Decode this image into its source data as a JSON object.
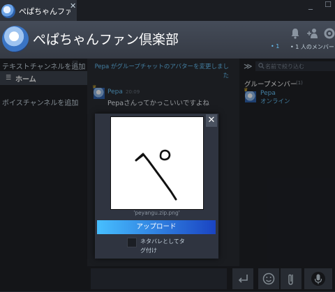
{
  "tab": {
    "title": "ぺぱちゃんファン",
    "close": "✕"
  },
  "window": {
    "minimize": "_",
    "maximize": "☐"
  },
  "header": {
    "group_name": "ぺぱちゃんファン倶楽部",
    "online_count": "• 1",
    "member_count": "• 1 人のメンバー"
  },
  "sidebar": {
    "add_text_channel": "テキストチャンネルを追加",
    "home_label": "ホーム",
    "add_voice_channel": "ボイスチャンネルを追加"
  },
  "chat": {
    "system_message": "Pepa がグループチャットのアバターを変更しました",
    "messages": [
      {
        "author": "Pepa",
        "time": "20:09",
        "text": "Pepaさんってかっこいいですよね"
      }
    ]
  },
  "members_panel": {
    "search_placeholder": "名前で絞り込む",
    "header": "グループメンバー",
    "count": "(1)",
    "members": [
      {
        "name": "Pepa",
        "status": "オンライン"
      }
    ]
  },
  "upload_dialog": {
    "close": "✕",
    "file_name": "'peyangu.zip.png'",
    "upload_label": "アップロード",
    "spoiler_label": "ネタバレとしてタグ付け"
  },
  "colors": {
    "accent_blue": "#66c0f4",
    "background": "#23262e",
    "upload_gradient_start": "#47bfff",
    "upload_gradient_end": "#1a44c2"
  }
}
